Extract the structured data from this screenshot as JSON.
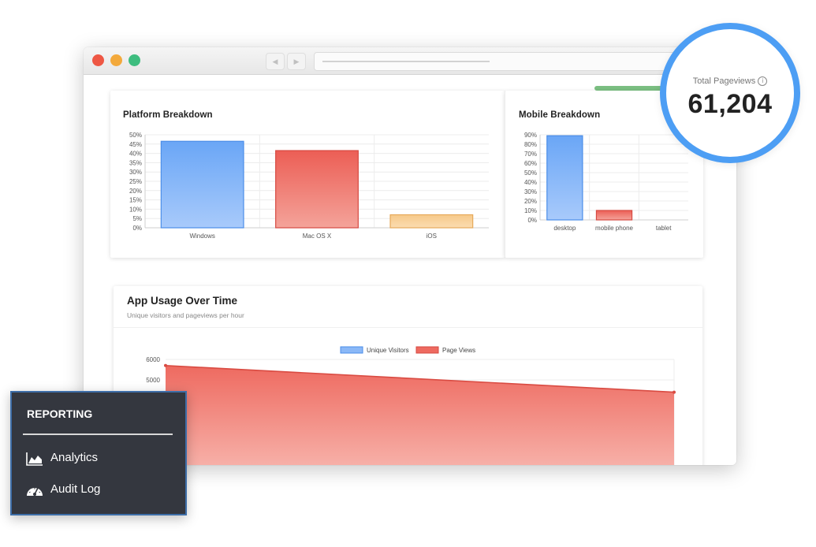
{
  "window": {
    "traffic_lights": [
      "close",
      "minimize",
      "maximize"
    ],
    "nav_icons": {
      "back": "back-arrow-icon",
      "forward": "forward-arrow-icon"
    }
  },
  "platform_card": {
    "title": "Platform Breakdown"
  },
  "mobile_card": {
    "title": "Mobile Breakdown"
  },
  "usage_card": {
    "title": "App Usage Over Time",
    "subtitle": "Unique visitors and pageviews per hour"
  },
  "total_pageviews": {
    "label": "Total Pageviews",
    "info_glyph": "i",
    "value": "61,204"
  },
  "sidebar": {
    "heading": "REPORTING",
    "items": [
      {
        "label": "Analytics",
        "icon": "area-chart-icon"
      },
      {
        "label": "Audit Log",
        "icon": "dashboard-gauge-icon"
      }
    ]
  },
  "colors": {
    "blue": "#4d9ef4",
    "red": "#e05050",
    "orange": "#f6c98a",
    "sidebar_bg": "#34373f"
  },
  "chart_data": [
    {
      "type": "bar",
      "title": "Platform Breakdown",
      "categories": [
        "Windows",
        "Mac OS X",
        "iOS"
      ],
      "values": [
        46.5,
        41.5,
        7
      ],
      "colors": [
        "#6ea8f6",
        "#ec5e55",
        "#f6c98a"
      ],
      "ylim": [
        0,
        50
      ],
      "yticks": [
        "0%",
        "5%",
        "10%",
        "15%",
        "20%",
        "25%",
        "30%",
        "35%",
        "40%",
        "45%",
        "50%"
      ],
      "grid": true
    },
    {
      "type": "bar",
      "title": "Mobile Breakdown",
      "categories": [
        "desktop",
        "mobile phone",
        "tablet"
      ],
      "values": [
        89,
        10,
        0
      ],
      "colors": [
        "#6ea8f6",
        "#ec5e55",
        "#f6c98a"
      ],
      "ylim": [
        0,
        90
      ],
      "yticks": [
        "0%",
        "10%",
        "20%",
        "30%",
        "40%",
        "50%",
        "60%",
        "70%",
        "80%",
        "90%"
      ],
      "grid": true
    },
    {
      "type": "area",
      "title": "App Usage Over Time",
      "legend": [
        "Unique Visitors",
        "Page Views"
      ],
      "legend_placement": "top-center",
      "x": [
        0,
        1
      ],
      "series": [
        {
          "name": "Page Views",
          "values": [
            5700,
            4400
          ]
        }
      ],
      "ylim": [
        0,
        6000
      ],
      "yticks": [
        "5000",
        "6000"
      ],
      "grid": true
    }
  ]
}
